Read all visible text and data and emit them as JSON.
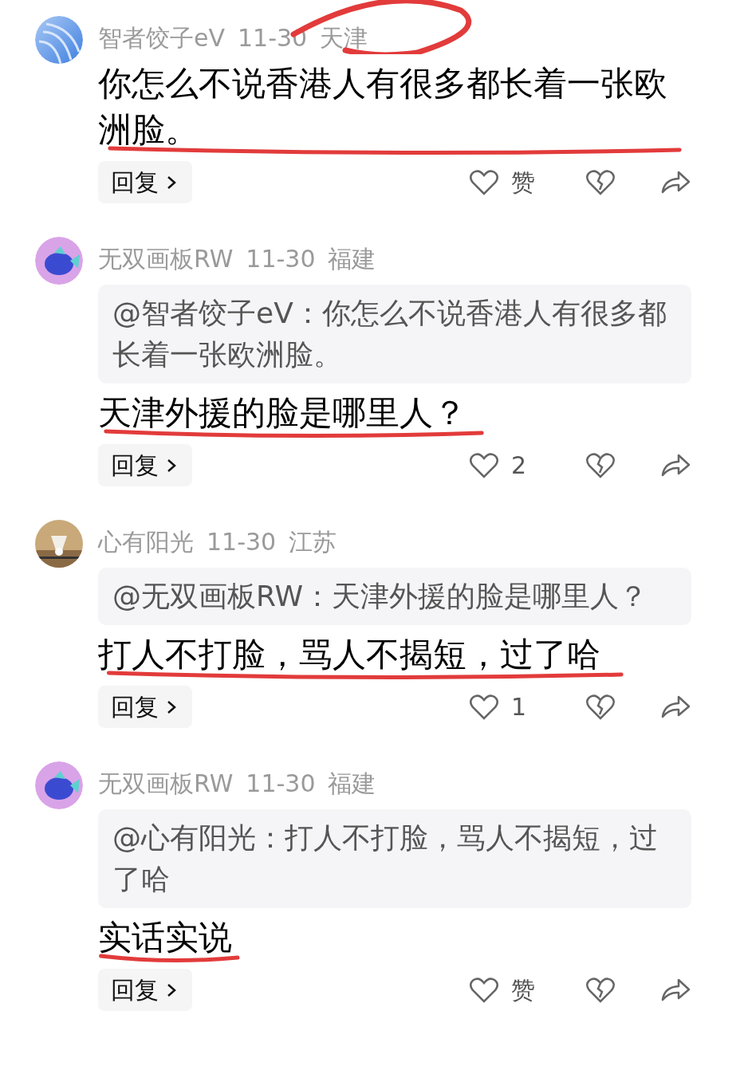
{
  "comments": [
    {
      "avatar": {
        "kind": "gradient"
      },
      "author": "智者饺子eV",
      "date": "11-30",
      "location": "天津",
      "meta_scribble": true,
      "text": "你怎么不说香港人有很多都长着一张欧洲脸。",
      "underlined": true,
      "reply_label": "回复",
      "like_label": "赞"
    },
    {
      "avatar": {
        "kind": "fish"
      },
      "author": "无双画板RW",
      "date": "11-30",
      "location": "福建",
      "meta_scribble": false,
      "quote": "@智者饺子eV：你怎么不说香港人有很多都长着一张欧洲脸。",
      "text": "天津外援的脸是哪里人？",
      "underlined": true,
      "reply_label": "回复",
      "like_label": "2"
    },
    {
      "author": "心有阳光",
      "date": "11-30",
      "location": "江苏",
      "meta_scribble": false,
      "quote": "@无双画板RW：天津外援的脸是哪里人？",
      "text": "打人不打脸，骂人不揭短，过了哈",
      "underlined": true,
      "reply_label": "回复",
      "like_label": "1"
    },
    {
      "avatar": {
        "kind": "fish"
      },
      "author": "无双画板RW",
      "date": "11-30",
      "location": "福建",
      "meta_scribble": false,
      "quote": "@心有阳光：打人不打脸，骂人不揭短，过了哈",
      "text": "实话实说",
      "underlined": true,
      "reply_label": "回复",
      "like_label": "赞"
    }
  ]
}
